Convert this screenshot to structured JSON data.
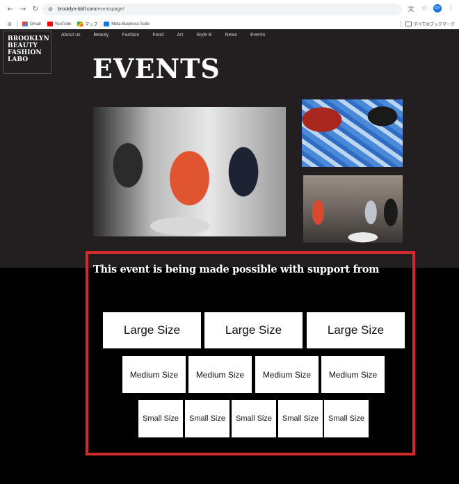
{
  "browser": {
    "url_host": "brooklyn-bbfl.com",
    "url_path": "/eventspage/",
    "bookmarks": [
      "Gmail",
      "YouTube",
      "マップ",
      "Meta Business Suite"
    ],
    "bookmarks_folder": "すべてのブックマーク",
    "profile_initials": "GY"
  },
  "site": {
    "logo_lines": [
      "BROOKLYN",
      "BEAUTY",
      "FASHION",
      "LABO"
    ],
    "nav": [
      "About us",
      "Beauty",
      "Fashion",
      "Food",
      "Art",
      "Style B",
      "News",
      "Events"
    ],
    "page_title": "EVENTS"
  },
  "sponsors": {
    "heading": "This event is being made possible with support from",
    "large": [
      "Large Size",
      "Large Size",
      "Large Size"
    ],
    "medium": [
      "Medium Size",
      "Medium Size",
      "Medium Size",
      "Medium Size"
    ],
    "small": [
      "Small Size",
      "Small Size",
      "Small Size",
      "Small Size",
      "Small Size"
    ]
  },
  "colors": {
    "hero_background": "#231f20",
    "page_background": "#000000",
    "highlight_frame": "#d12b2b"
  }
}
